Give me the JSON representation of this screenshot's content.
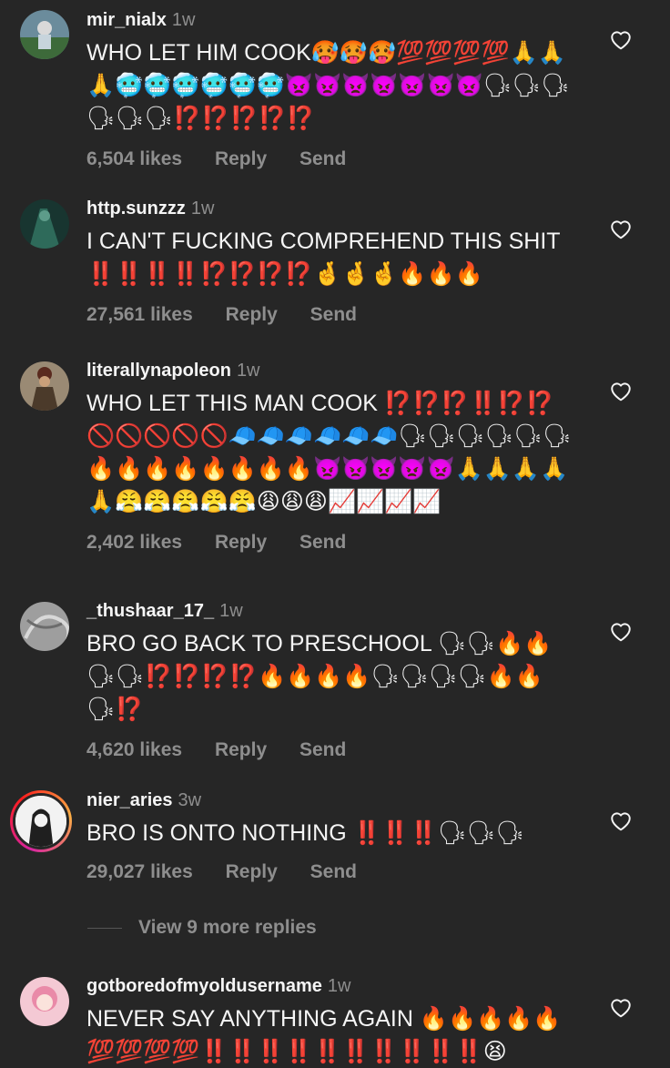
{
  "comments": [
    {
      "username": "mir_nialx",
      "time": "1w",
      "text": "WHO LET HIM COOK🥵🥵🥵💯💯💯💯🙏🙏🙏🥶🥶🥶🥶🥶🥶👿👿👿👿👿👿👿🗣🗣🗣🗣🗣🗣⁉️⁉️⁉️⁉️⁉️",
      "likes": "6,504 likes",
      "reply": "Reply",
      "send": "Send"
    },
    {
      "username": "http.sunzzz",
      "time": "1w",
      "text": "I CAN'T FUCKING COMPREHEND THIS SHIT ‼️‼️‼️‼️⁉️⁉️⁉️⁉️🤞🤞🤞🔥🔥🔥",
      "likes": "27,561 likes",
      "reply": "Reply",
      "send": "Send"
    },
    {
      "username": "literallynapoleon",
      "time": "1w",
      "text": "WHO LET THIS MAN COOK ⁉️⁉️⁉️‼️⁉️⁉️🚫🚫🚫🚫🚫🧢🧢🧢🧢🧢🧢🗣🗣🗣🗣🗣🗣🔥🔥🔥🔥🔥🔥🔥🔥👿👿👿👿👿🙏🙏🙏🙏🙏😤😤😤😤😤😩😩😩📈📈📈📈",
      "likes": "2,402 likes",
      "reply": "Reply",
      "send": "Send"
    },
    {
      "username": "_thushaar_17_",
      "time": "1w",
      "text": "BRO GO BACK TO PRESCHOOL 🗣🗣🔥🔥🗣🗣⁉️⁉️⁉️⁉️🔥🔥🔥🔥🗣🗣🗣🗣🔥🔥🗣⁉️",
      "likes": "4,620 likes",
      "reply": "Reply",
      "send": "Send"
    },
    {
      "username": "nier_aries",
      "time": "3w",
      "text": "BRO IS ONTO NOTHING ‼️‼️‼️🗣🗣🗣",
      "likes": "29,027 likes",
      "reply": "Reply",
      "send": "Send"
    },
    {
      "username": "gotboredofmyoldusername",
      "time": "1w",
      "text": "NEVER SAY ANYTHING AGAIN 🔥🔥🔥🔥🔥💯💯💯💯‼️‼️‼️‼️‼️‼️‼️‼️‼️‼️😫"
    }
  ],
  "view_more_replies": "View 9 more replies"
}
